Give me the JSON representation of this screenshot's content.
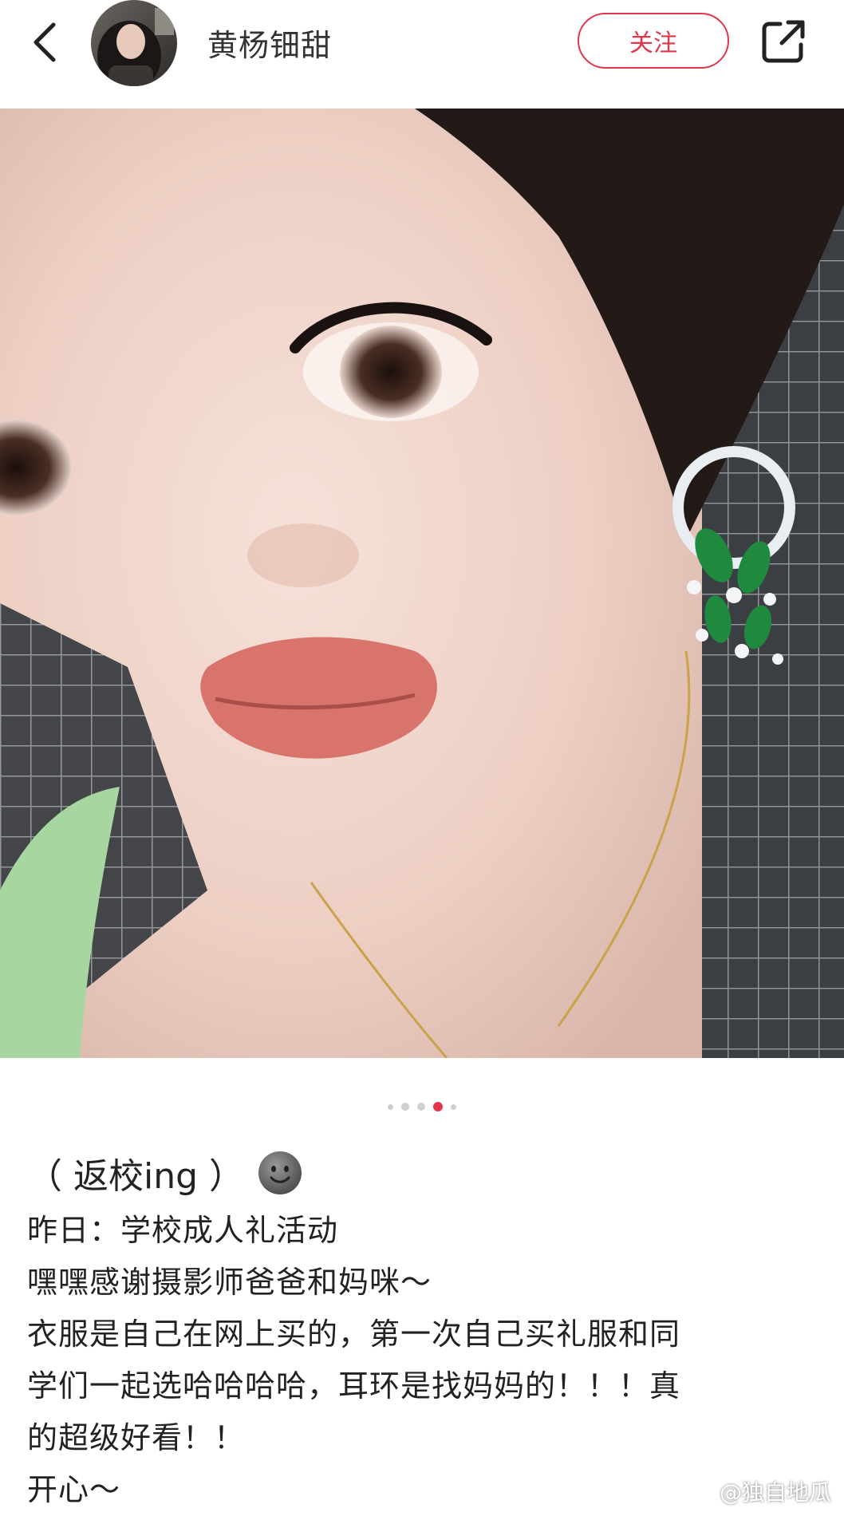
{
  "header": {
    "username": "黄杨钿甜",
    "follow_label": "关注"
  },
  "carousel": {
    "total": 5,
    "active_index": 3
  },
  "post": {
    "title": "（ 返校ing ）",
    "lines": [
      "昨日：学校成人礼活动",
      "嘿嘿感谢摄影师爸爸和妈咪～",
      "衣服是自己在网上买的，第一次自己买礼服和同",
      "学们一起选哈哈哈哈，耳环是找妈妈的！！！真",
      "的超级好看！！",
      "开心～"
    ]
  },
  "watermark": {
    "text": "@独自地瓜"
  },
  "colors": {
    "accent": "#e2364c"
  }
}
